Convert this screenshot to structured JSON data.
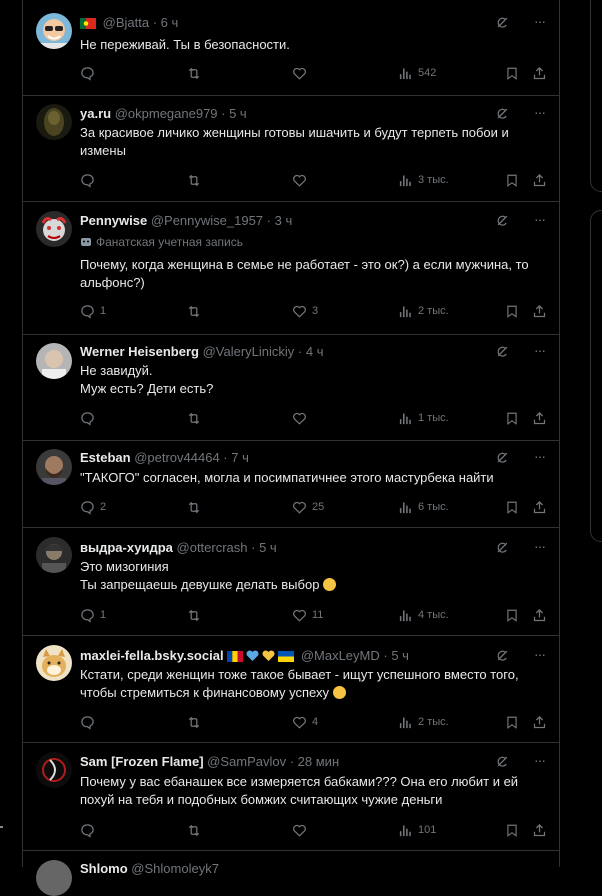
{
  "posts": [
    {
      "display_name": "",
      "handle": "@Bjatta",
      "time": "6 ч",
      "has_flag": true,
      "badge": "",
      "text_lines": [
        "Не переживай. Ты в безопасности."
      ],
      "counts": {
        "replies": "",
        "reposts": "",
        "likes": "",
        "views": "542"
      }
    },
    {
      "display_name": "ya.ru",
      "handle": "@okpmegane979",
      "time": "5 ч",
      "badge": "",
      "text_lines": [
        "За красивое личико женщины готовы ишачить и будут терпеть побои и",
        "измены"
      ],
      "counts": {
        "replies": "",
        "reposts": "",
        "likes": "",
        "views": "3 тыс."
      }
    },
    {
      "display_name": "Pennywise",
      "handle": "@Pennywise_1957",
      "time": "3 ч",
      "badge": "Фанатская учетная запись",
      "text_lines": [
        "Почему, когда женщина в семье не работает - это ок?) а если мужчина, то",
        "альфонс?)"
      ],
      "counts": {
        "replies": "1",
        "reposts": "",
        "likes": "3",
        "views": "2 тыс."
      }
    },
    {
      "display_name": "Werner Heisenberg",
      "handle": "@ValeryLinickiy",
      "time": "4 ч",
      "badge": "",
      "text_lines": [
        "Не завидуй.",
        "Муж есть? Дети есть?"
      ],
      "counts": {
        "replies": "",
        "reposts": "",
        "likes": "",
        "views": "1 тыс."
      }
    },
    {
      "display_name": "Esteban",
      "handle": "@petrov44464",
      "time": "7 ч",
      "badge": "",
      "text_lines": [
        "\"ТАКОГО\" согласен, могла и посимпатичнее этого мастурбека найти"
      ],
      "counts": {
        "replies": "2",
        "reposts": "",
        "likes": "25",
        "views": "6 тыс."
      }
    },
    {
      "display_name": "выдра-хуидра",
      "handle": "@ottercrash",
      "time": "5 ч",
      "badge": "",
      "text_lines": [
        "Это мизогиния",
        "Ты запрещаешь девушке делать выбор"
      ],
      "counts": {
        "replies": "1",
        "reposts": "",
        "likes": "11",
        "views": "4 тыс."
      }
    },
    {
      "display_name": "maxlei-fella.bsky.social",
      "handle": "@MaxLeyMD",
      "time": "5 ч",
      "badge": "",
      "text_lines": [
        "Кстати, среди женщин тоже такое бывает - ищут успешного вместо того,",
        "чтобы стремиться к финансовому успеху"
      ],
      "counts": {
        "replies": "",
        "reposts": "",
        "likes": "4",
        "views": "2 тыс."
      }
    },
    {
      "display_name": "Sam [Frozen Flame]",
      "handle": "@SamPavlov",
      "time": "28 мин",
      "badge": "",
      "text_lines": [
        "Почему у вас ебанашек все измеряется бабками??? Она его любит и ей",
        "похуй на тебя и подобных бомжих считающих чужие деньги"
      ],
      "counts": {
        "replies": "",
        "reposts": "",
        "likes": "",
        "views": "101"
      }
    },
    {
      "display_name": "Shlomo",
      "handle": "@Shlomoleyk7",
      "time": "",
      "badge": "",
      "text_lines": [],
      "counts": {
        "replies": "",
        "reposts": "",
        "likes": "",
        "views": ""
      }
    }
  ],
  "colors": {
    "background": "#000000",
    "border": "#2f3336",
    "text": "#e7e9ea",
    "muted": "#71767b"
  },
  "icons": [
    "reply-icon",
    "repost-icon",
    "like-icon",
    "views-icon",
    "bookmark-icon",
    "share-icon",
    "grok-icon",
    "more-icon",
    "fan-account-icon"
  ]
}
